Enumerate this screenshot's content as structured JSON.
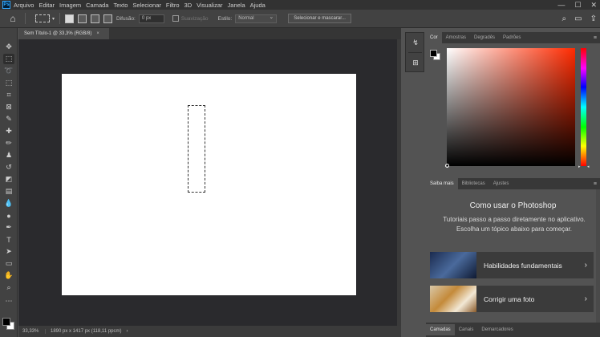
{
  "menubar": {
    "logo": "Ps",
    "items": [
      "Arquivo",
      "Editar",
      "Imagem",
      "Camada",
      "Texto",
      "Selecionar",
      "Filtro",
      "3D",
      "Visualizar",
      "Janela",
      "Ajuda"
    ],
    "controls": {
      "minimize": "—",
      "maximize": "☐",
      "close": "✕"
    }
  },
  "options": {
    "feather_label": "Difusão:",
    "feather_value": "0 px",
    "antialias_label": "Suavização",
    "style_label": "Estilo:",
    "style_value": "Normal",
    "select_mask_label": "Selecionar e mascarar..."
  },
  "document": {
    "tab_title": "Sem Título-1 @ 33,3% (RGB/8)",
    "tab_close": "×"
  },
  "status": {
    "zoom": "33,33%",
    "info": "1890 px x 1417 px (118,11 ppcm)",
    "arrow": "›"
  },
  "color_panel": {
    "tabs": [
      "Cor",
      "Amostras",
      "Degradês",
      "Padrões"
    ],
    "active_tab": "Cor",
    "hue_color": "#ff2a00"
  },
  "learn_panel": {
    "tabs": [
      "Saiba mais",
      "Bibliotecas",
      "Ajustes"
    ],
    "title": "Como usar o Photoshop",
    "subtitle": "Tutoriais passo a passo diretamente no aplicativo. Escolha um tópico abaixo para começar.",
    "cards": [
      {
        "label": "Habilidades fundamentais",
        "chevron": "›"
      },
      {
        "label": "Corrigir uma foto",
        "chevron": "›"
      }
    ]
  },
  "bottom_panel": {
    "tabs": [
      "Camadas",
      "Canais",
      "Demarcadores"
    ]
  },
  "icons": {
    "home": "⌂",
    "search": "⌕",
    "workspace": "▭",
    "share": "⇪",
    "panel_menu": "≡"
  }
}
